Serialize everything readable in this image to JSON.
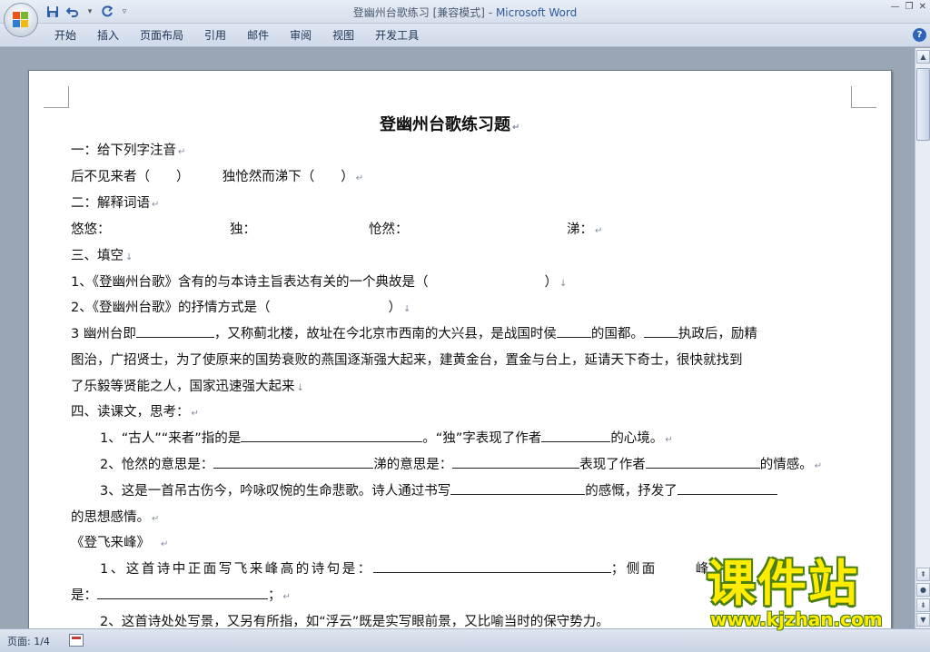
{
  "window": {
    "doc_title": "登幽州台歌练习 [兼容模式]",
    "separator": " - ",
    "app_name": "Microsoft Word"
  },
  "ribbon": {
    "tabs": [
      "开始",
      "插入",
      "页面布局",
      "引用",
      "邮件",
      "审阅",
      "视图",
      "开发工具"
    ]
  },
  "document": {
    "title": "登幽州台歌练习题",
    "lines": [
      "一：给下列字注音",
      "后不见来者（　　）　　　独怆然而涕下（　　）",
      "二：解释词语",
      "悠悠：",
      "独：",
      "怆然：",
      "涕：",
      "三、填空",
      "1、《登幽州台歌》含有的与本诗主旨表达有关的一个典故是（",
      "）",
      "2、《登幽州台歌》的抒情方式是（",
      "）",
      "3 幽州台即",
      "，又称蓟北楼，故址在今北京市西南的大兴县，是战国时侯",
      "的国都。",
      "执政后，励精",
      "图治，广招贤士，为了使原来的国势衰败的燕国逐渐强大起来，建黄金台，置金与台上，延请天下奇士，很快就找到",
      "了乐毅等贤能之人，国家迅速强大起来",
      "四、读课文，思考：",
      "1、“古人”“来者”指的是",
      "。“独”字表现了作者",
      "的心境。",
      "2、怆然的意思是：",
      "涕的意思是：",
      "表现了作者",
      "的情感。",
      "3、这是一首吊古伤今，吟咏叹惋的生命悲歌。诗人通过书写",
      "的感慨，抒发了",
      "的思想感情。",
      "《登飞来峰》",
      "1、这首诗中正面写飞来峰高的诗句是：",
      "；侧面",
      "峰",
      "诗句",
      "是：",
      "；",
      "2、这首诗处处写景，又另有所指，如“浮云”既是实写眼前景，又比喻当时的保守势力。"
    ]
  },
  "status": {
    "page": "页面: 1/4"
  },
  "watermark": {
    "title": "课件站",
    "url": "www.kjzhan.com"
  },
  "colors": {
    "ribbon_bg": "#dfe7f2",
    "workspace_bg": "#9aa6b4",
    "app_name": "#2c5a9c",
    "watermark": "#ffec00"
  }
}
